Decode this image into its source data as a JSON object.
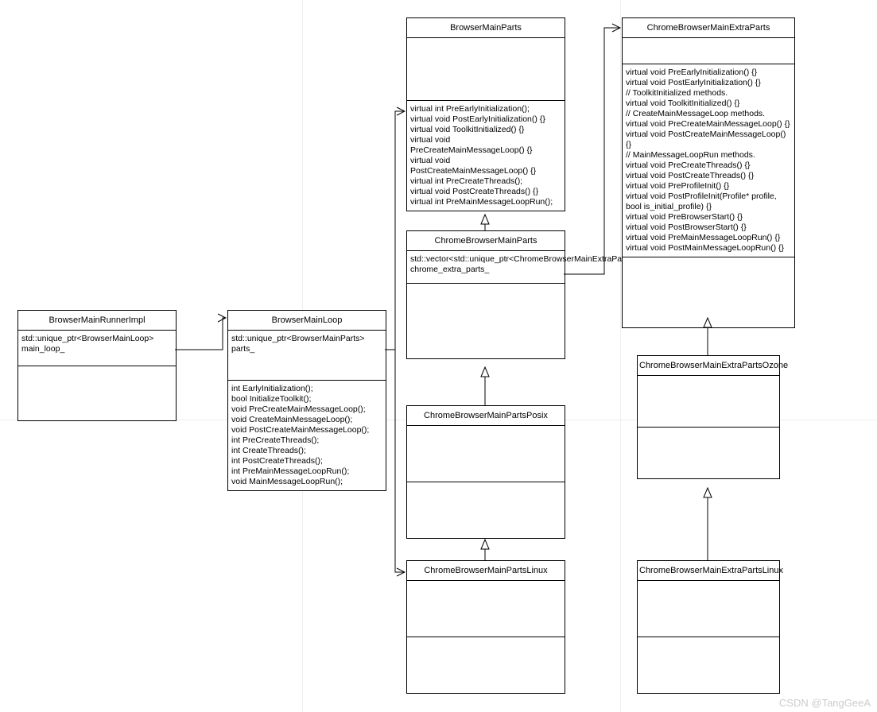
{
  "classes": {
    "browserMainRunnerImpl": {
      "title": "BrowserMainRunnerImpl",
      "attrs": "std::unique_ptr<BrowserMainLoop> main_loop_",
      "ops": ""
    },
    "browserMainLoop": {
      "title": "BrowserMainLoop",
      "attrs": "std::unique_ptr<BrowserMainParts> parts_",
      "ops": "int EarlyInitialization();\nbool InitializeToolkit();\nvoid PreCreateMainMessageLoop();\nvoid CreateMainMessageLoop();\nvoid PostCreateMainMessageLoop();\nint PreCreateThreads();\nint CreateThreads();\nint PostCreateThreads();\nint PreMainMessageLoopRun();\nvoid MainMessageLoopRun();"
    },
    "browserMainParts": {
      "title": "BrowserMainParts",
      "attrs": "",
      "ops": "virtual int PreEarlyInitialization();\nvirtual void PostEarlyInitialization() {}\nvirtual void ToolkitInitialized() {}\nvirtual void PreCreateMainMessageLoop() {}\n virtual void PostCreateMainMessageLoop() {}\n  virtual int PreCreateThreads();\nvirtual void PostCreateThreads() {}\nvirtual int PreMainMessageLoopRun();"
    },
    "chromeBrowserMainParts": {
      "title": "ChromeBrowserMainParts",
      "attrs": "std::vector<std::unique_ptr<ChromeBrowserMainExtraParts>> chrome_extra_parts_",
      "ops": ""
    },
    "chromeBrowserMainPartsPosix": {
      "title": "ChromeBrowserMainPartsPosix",
      "attrs": "",
      "ops": ""
    },
    "chromeBrowserMainPartsLinux": {
      "title": "ChromeBrowserMainPartsLinux",
      "attrs": "",
      "ops": ""
    },
    "chromeBrowserMainExtraParts": {
      "title": "ChromeBrowserMainExtraParts",
      "attrs": "",
      "ops": "virtual void PreEarlyInitialization() {}\n  virtual void PostEarlyInitialization() {}\n  // ToolkitInitialized methods.\n  virtual void ToolkitInitialized() {}\n  // CreateMainMessageLoop methods.\n  virtual void PreCreateMainMessageLoop() {}\n  virtual void PostCreateMainMessageLoop() {}\n  // MainMessageLoopRun methods.\n  virtual void PreCreateThreads() {}\n  virtual void PostCreateThreads() {}\n  virtual void PreProfileInit() {}\n  virtual void PostProfileInit(Profile* profile, bool is_initial_profile) {}\n  virtual void PreBrowserStart() {}\n  virtual void PostBrowserStart() {}\n  virtual void PreMainMessageLoopRun() {}\n  virtual void PostMainMessageLoopRun() {}"
    },
    "chromeBrowserMainExtraPartsOzone": {
      "title": "ChromeBrowserMainExtraPartsOzone",
      "attrs": "",
      "ops": ""
    },
    "chromeBrowserMainExtraPartsLinux": {
      "title": "ChromeBrowserMainExtraPartsLinux",
      "attrs": "",
      "ops": ""
    }
  },
  "watermark": "CSDN @TangGeeA",
  "chart_data": {
    "type": "uml-class-diagram",
    "classes": [
      {
        "name": "BrowserMainRunnerImpl",
        "attributes": [
          "std::unique_ptr<BrowserMainLoop> main_loop_"
        ],
        "operations": []
      },
      {
        "name": "BrowserMainLoop",
        "attributes": [
          "std::unique_ptr<BrowserMainParts> parts_"
        ],
        "operations": [
          "int EarlyInitialization()",
          "bool InitializeToolkit()",
          "void PreCreateMainMessageLoop()",
          "void CreateMainMessageLoop()",
          "void PostCreateMainMessageLoop()",
          "int PreCreateThreads()",
          "int CreateThreads()",
          "int PostCreateThreads()",
          "int PreMainMessageLoopRun()",
          "void MainMessageLoopRun()"
        ]
      },
      {
        "name": "BrowserMainParts",
        "attributes": [],
        "operations": [
          "virtual int PreEarlyInitialization()",
          "virtual void PostEarlyInitialization() {}",
          "virtual void ToolkitInitialized() {}",
          "virtual void PreCreateMainMessageLoop() {}",
          "virtual void PostCreateMainMessageLoop() {}",
          "virtual int PreCreateThreads()",
          "virtual void PostCreateThreads() {}",
          "virtual int PreMainMessageLoopRun()"
        ]
      },
      {
        "name": "ChromeBrowserMainParts",
        "attributes": [
          "std::vector<std::unique_ptr<ChromeBrowserMainExtraParts>> chrome_extra_parts_"
        ],
        "operations": []
      },
      {
        "name": "ChromeBrowserMainPartsPosix",
        "attributes": [],
        "operations": []
      },
      {
        "name": "ChromeBrowserMainPartsLinux",
        "attributes": [],
        "operations": []
      },
      {
        "name": "ChromeBrowserMainExtraParts",
        "attributes": [],
        "operations": [
          "virtual void PreEarlyInitialization() {}",
          "virtual void PostEarlyInitialization() {}",
          "// ToolkitInitialized methods.",
          "virtual void ToolkitInitialized() {}",
          "// CreateMainMessageLoop methods.",
          "virtual void PreCreateMainMessageLoop() {}",
          "virtual void PostCreateMainMessageLoop() {}",
          "// MainMessageLoopRun methods.",
          "virtual void PreCreateThreads() {}",
          "virtual void PostCreateThreads() {}",
          "virtual void PreProfileInit() {}",
          "virtual void PostProfileInit(Profile* profile, bool is_initial_profile) {}",
          "virtual void PreBrowserStart() {}",
          "virtual void PostBrowserStart() {}",
          "virtual void PreMainMessageLoopRun() {}",
          "virtual void PostMainMessageLoopRun() {}"
        ]
      },
      {
        "name": "ChromeBrowserMainExtraPartsOzone",
        "attributes": [],
        "operations": []
      },
      {
        "name": "ChromeBrowserMainExtraPartsLinux",
        "attributes": [],
        "operations": []
      }
    ],
    "relationships": [
      {
        "from": "BrowserMainRunnerImpl",
        "to": "BrowserMainLoop",
        "type": "association-open-arrow"
      },
      {
        "from": "BrowserMainLoop",
        "to": "BrowserMainParts",
        "type": "association-open-arrow"
      },
      {
        "from": "BrowserMainLoop",
        "to": "ChromeBrowserMainPartsLinux",
        "type": "association-open-arrow"
      },
      {
        "from": "ChromeBrowserMainParts",
        "to": "BrowserMainParts",
        "type": "generalization"
      },
      {
        "from": "ChromeBrowserMainPartsPosix",
        "to": "ChromeBrowserMainParts",
        "type": "generalization"
      },
      {
        "from": "ChromeBrowserMainPartsLinux",
        "to": "ChromeBrowserMainPartsPosix",
        "type": "generalization"
      },
      {
        "from": "ChromeBrowserMainParts",
        "to": "ChromeBrowserMainExtraParts",
        "type": "association-open-arrow"
      },
      {
        "from": "ChromeBrowserMainExtraPartsOzone",
        "to": "ChromeBrowserMainExtraParts",
        "type": "generalization"
      },
      {
        "from": "ChromeBrowserMainExtraPartsLinux",
        "to": "ChromeBrowserMainExtraPartsOzone",
        "type": "generalization"
      }
    ]
  }
}
